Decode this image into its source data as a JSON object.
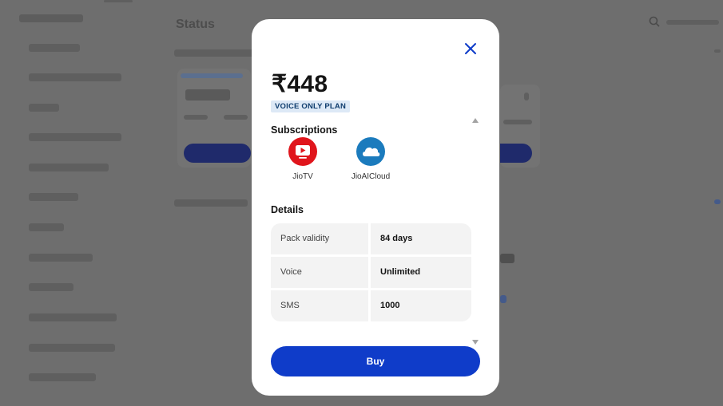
{
  "background": {
    "title": "Status"
  },
  "modal": {
    "price": "₹448",
    "badge": "VOICE ONLY PLAN",
    "subscriptions_title": "Subscriptions",
    "subscriptions": [
      {
        "label": "JioTV",
        "icon": "tv-play-icon",
        "color": "#e0151c"
      },
      {
        "label": "JioAICloud",
        "icon": "cloud-icon",
        "color": "#1b7bbd"
      }
    ],
    "details_title": "Details",
    "details": [
      {
        "key": "Pack validity",
        "value": "84 days"
      },
      {
        "key": "Voice",
        "value": "Unlimited"
      },
      {
        "key": "SMS",
        "value": "1000"
      }
    ],
    "buy_label": "Buy",
    "accent_color": "#0f3cc9"
  }
}
